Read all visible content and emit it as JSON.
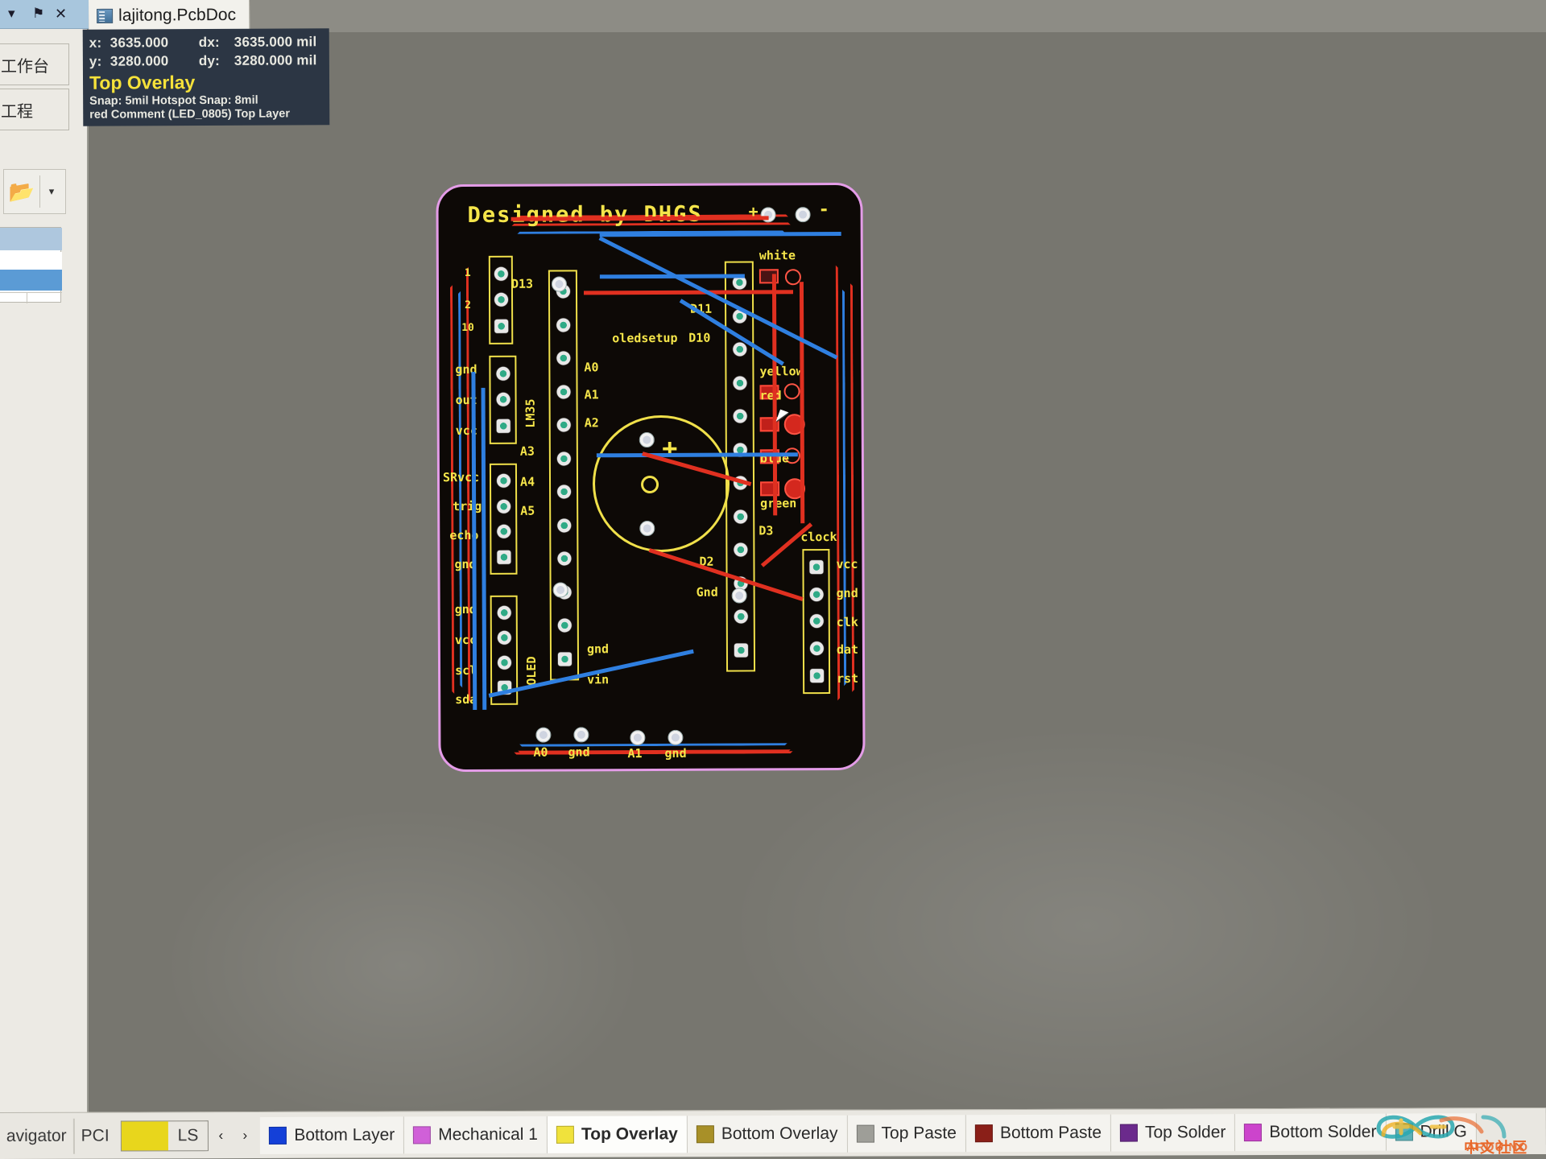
{
  "panel": {
    "titlebar_icons": [
      "chevron-down-icon",
      "pin-icon",
      "close-icon"
    ],
    "down_glyph": "▾",
    "pin_glyph": "⚑",
    "close_glyph": "✕",
    "box1_label": "工作台",
    "box2_label": "工程",
    "open_icon_glyph": "📂",
    "open_caret_glyph": "▾"
  },
  "document_tab": {
    "label": "lajitong.PcbDoc",
    "icon": "pcb-document-icon"
  },
  "hud": {
    "x_key": "x:",
    "x_value": "3635.000",
    "dx_key": "dx:",
    "dx_value": "3635.000 mil",
    "y_key": "y:",
    "y_value": "3280.000",
    "dy_key": "dy:",
    "dy_value": "3280.000 mil",
    "layer": "Top Overlay",
    "snap": "Snap: 5mil Hotspot Snap: 8mil",
    "object": "red Comment (LED_0805) Top Layer"
  },
  "pcb": {
    "title": "Designed by DHGS",
    "board_outline_color": "#e49ce8",
    "silkscreen_color": "#f5e54a",
    "top_layer_color": "#e03020",
    "bottom_layer_color": "#2f7fe0",
    "left_labels": [
      "gnd",
      "out",
      "vcc",
      "SRvcc",
      "trig",
      "echo",
      "gnd",
      "gnd",
      "vcc",
      "scl",
      "sda"
    ],
    "left_connector_names": [
      "LM35",
      "OLED"
    ],
    "mid_labels": [
      "D13",
      "A0",
      "A1",
      "A2",
      "A3",
      "A4",
      "A5",
      "gnd",
      "vin"
    ],
    "right_labels": [
      "D11",
      "D10",
      "D3",
      "D2",
      "Gnd"
    ],
    "net_label": "oledsetup",
    "led_labels": [
      "white",
      "yellow",
      "red",
      "blue",
      "green"
    ],
    "clock_header": "clock",
    "clock_pins": [
      "vcc",
      "gnd",
      "clk",
      "dat",
      "rst"
    ],
    "bottom_labels": [
      "A0",
      "gnd",
      "A1",
      "gnd"
    ],
    "plus_sign": "+",
    "minus_sign": "-"
  },
  "bottom_bar": {
    "left_texts": [
      "avigator",
      "PCI"
    ],
    "ls_swatch_color": "#e8d61c",
    "ls_label": "LS",
    "prev_glyph": "‹",
    "next_glyph": "›",
    "layer_tabs": [
      {
        "label": "Bottom Layer",
        "color": "#1440d8",
        "active": false
      },
      {
        "label": "Mechanical 1",
        "color": "#d060d8",
        "active": false
      },
      {
        "label": "Top Overlay",
        "color": "#f0e23c",
        "active": true
      },
      {
        "label": "Bottom Overlay",
        "color": "#a89028",
        "active": false
      },
      {
        "label": "Top Paste",
        "color": "#9e9e98",
        "active": false
      },
      {
        "label": "Bottom Paste",
        "color": "#8a1f18",
        "active": false
      },
      {
        "label": "Top Solder",
        "color": "#6b2a8c",
        "active": false
      },
      {
        "label": "Bottom Solder",
        "color": "#cc44cc",
        "active": false
      },
      {
        "label": "Drill G",
        "color": "#5ab0b8",
        "active": false
      }
    ]
  },
  "watermark": {
    "line1": "ARDUINO",
    "line2": "中文社区"
  }
}
